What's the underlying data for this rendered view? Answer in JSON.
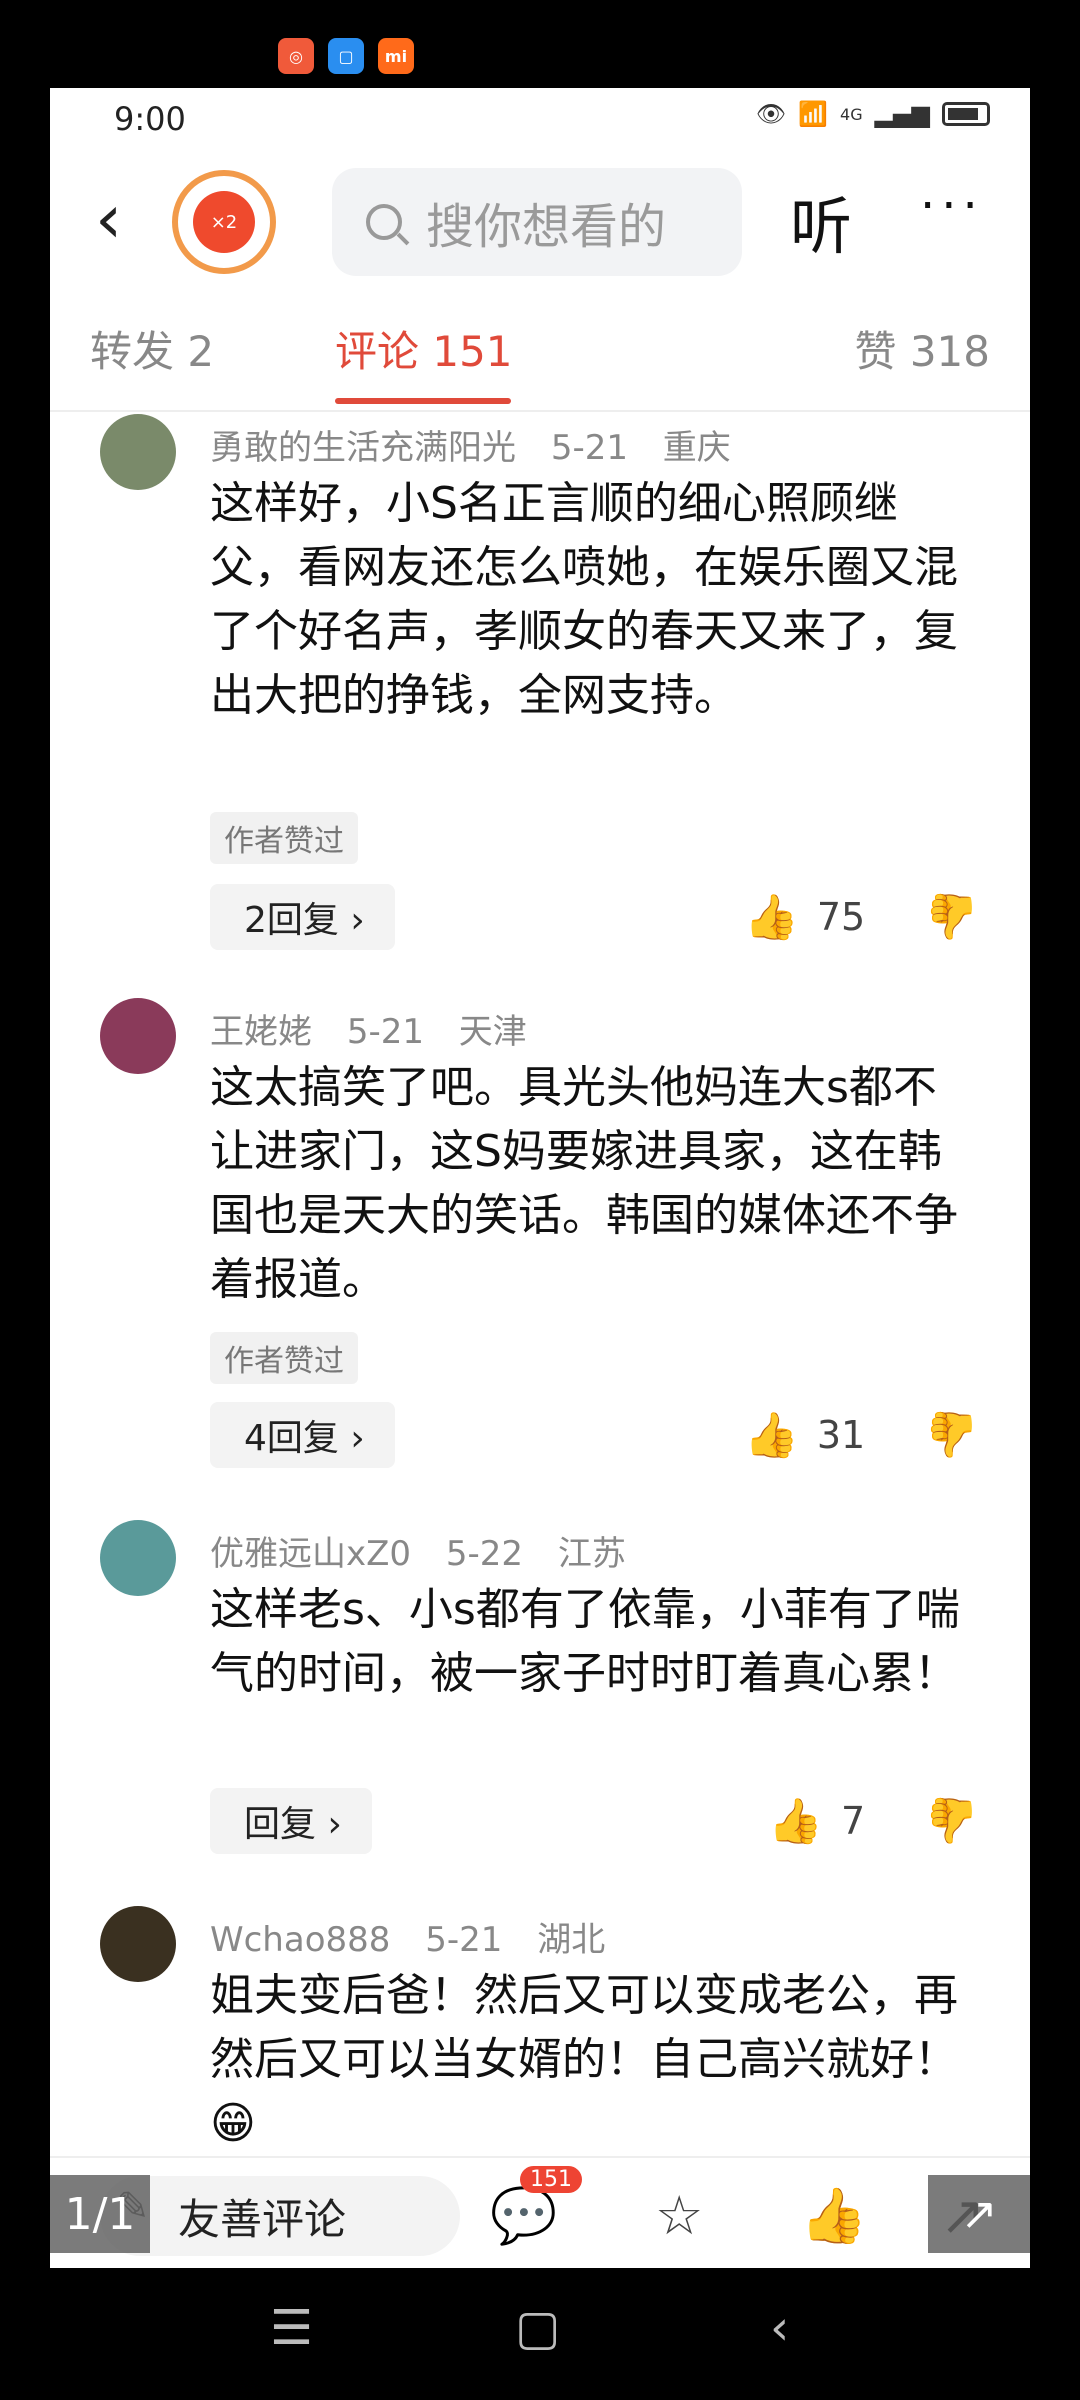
{
  "top_app_icons": [
    "app-red-icon",
    "app-blue-icon",
    "mi-icon"
  ],
  "status": {
    "time": "9:00",
    "network": "4G"
  },
  "header": {
    "search_placeholder": "搜你想看的",
    "listen_label": "听",
    "more_label": "···"
  },
  "tabs": [
    {
      "label": "转发 2"
    },
    {
      "label": "评论 151"
    },
    {
      "label": "赞 318"
    }
  ],
  "comments": [
    {
      "name": "勇敢的生活充满阳光",
      "date": "5-21",
      "location": "重庆",
      "text": "这样好，小S名正言顺的细心照顾继父，看网友还怎么喷她，在娱乐圈又混了个好名声，孝顺女的春天又来了，复出大把的挣钱，全网支持。",
      "badge": "作者赞过",
      "replies": "2回复 ›",
      "likes": "75",
      "avatar_color": "#7a8a6a"
    },
    {
      "name": "王姥姥",
      "date": "5-21",
      "location": "天津",
      "text": "这太搞笑了吧。具光头他妈连大s都不让进家门，这S妈要嫁进具家，这在韩国也是天大的笑话。韩国的媒体还不争着报道。",
      "badge": "作者赞过",
      "replies": "4回复 ›",
      "likes": "31",
      "avatar_color": "#8a3a5a"
    },
    {
      "name": "优雅远山xZ0",
      "date": "5-22",
      "location": "江苏",
      "text": "这样老s、小s都有了依靠，小菲有了喘气的时间，被一家子时时盯着真心累！",
      "badge": "",
      "replies": "回复 ›",
      "likes": "7",
      "avatar_color": "#5a9a9a"
    },
    {
      "name": "Wchao888",
      "date": "5-21",
      "location": "湖北",
      "text": "姐夫变后爸！然后又可以变成老公，再然后又可以当女婿的！自己高兴就好！😁",
      "badge": "",
      "replies": "",
      "likes": "",
      "avatar_color": "#3a3020"
    }
  ],
  "bottom_bar": {
    "input_placeholder": "友善评论",
    "comment_count": "151"
  },
  "overlay": {
    "pager": "1/1"
  }
}
